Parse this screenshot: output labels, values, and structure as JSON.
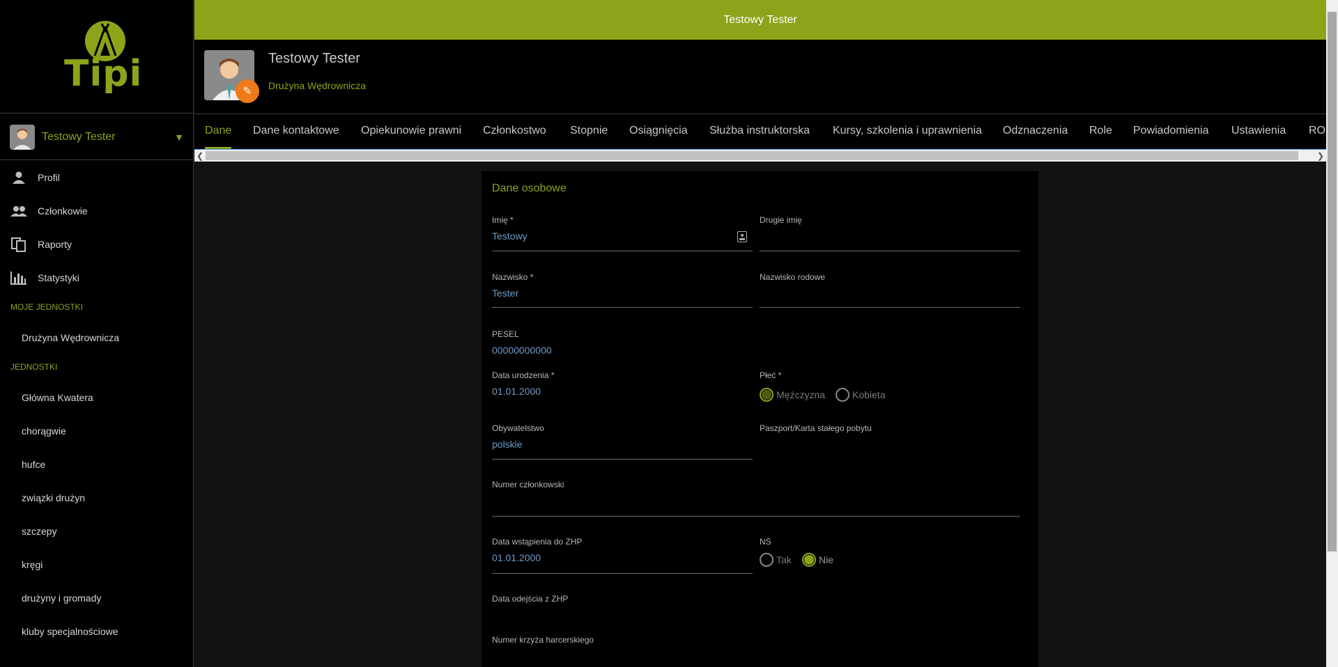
{
  "topbar": {
    "title": "Testowy Tester"
  },
  "logo": {
    "text": "Tipi"
  },
  "sidebar": {
    "user_name": "Testowy Tester",
    "nav": [
      {
        "label": "Profil",
        "icon": "person-icon"
      },
      {
        "label": "Członkowie",
        "icon": "people-icon"
      },
      {
        "label": "Raporty",
        "icon": "reports-icon"
      },
      {
        "label": "Statystyki",
        "icon": "stats-icon"
      }
    ],
    "my_units_title": "MOJE JEDNOSTKI",
    "my_units": [
      "Drużyna Wędrownicza"
    ],
    "units_title": "JEDNOSTKI",
    "units": [
      "Główna Kwatera",
      "chorągwie",
      "hufce",
      "związki drużyn",
      "szczepy",
      "kręgi",
      "drużyny i gromady",
      "kluby specjalnościowe"
    ]
  },
  "header": {
    "name": "Testowy Tester",
    "unit": "Drużyna Wędrownicza"
  },
  "tabs": [
    "Dane",
    "Dane kontaktowe",
    "Opiekunowie prawni",
    "Członkostwo",
    "Stopnie",
    "Osiągnięcia",
    "Służba instruktorska",
    "Kursy, szkolenia i uprawnienia",
    "Odznaczenia",
    "Role",
    "Powiadomienia",
    "Ustawienia",
    "RODO"
  ],
  "form": {
    "title": "Dane osobowe",
    "first_name": {
      "label": "Imię *",
      "value": "Testowy"
    },
    "second_name": {
      "label": "Drugie imię",
      "value": ""
    },
    "last_name": {
      "label": "Nazwisko *",
      "value": "Tester"
    },
    "family_name": {
      "label": "Nazwisko rodowe",
      "value": ""
    },
    "pesel": {
      "label": "PESEL",
      "value": "00000000000"
    },
    "birth_date": {
      "label": "Data urodzenia *",
      "value": "01.01.2000"
    },
    "gender": {
      "label": "Płeć *",
      "options": [
        "Mężczyzna",
        "Kobieta"
      ],
      "selected": "Mężczyzna"
    },
    "citizenship": {
      "label": "Obywatelstwo",
      "value": "polskie"
    },
    "passport": {
      "label": "Paszport/Karta stałego pobytu",
      "value": ""
    },
    "member_number": {
      "label": "Numer członkowski",
      "value": ""
    },
    "join_date": {
      "label": "Data wstąpienia do ZHP",
      "value": "01.01.2000"
    },
    "ns": {
      "label": "NS",
      "options": [
        "Tak",
        "Nie"
      ],
      "selected": "Nie"
    },
    "leave_date": {
      "label": "Data odejścia z ZHP",
      "value": ""
    },
    "cross_number": {
      "label": "Numer krzyża harcerskiego",
      "value": ""
    }
  },
  "colors": {
    "accent": "#8ca41a",
    "edit": "#f07a1a",
    "value": "#6e9bc4"
  }
}
